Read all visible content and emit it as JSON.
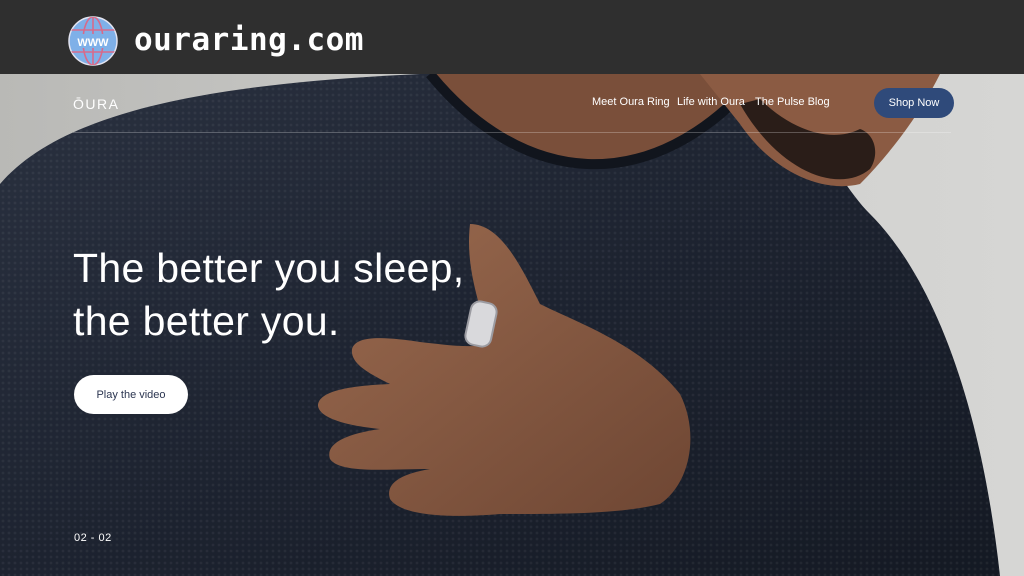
{
  "browser": {
    "url": "ouraring.com",
    "globe_label": "WWW"
  },
  "nav": {
    "logo": "ŌURA",
    "links": [
      "Meet Oura Ring",
      "Life with Oura",
      "The Pulse Blog"
    ],
    "cta": "Shop Now"
  },
  "hero": {
    "headline_line1": "The better you sleep,",
    "headline_line2": "the better you.",
    "play_label": "Play the video",
    "slide_counter": "02 - 02"
  },
  "colors": {
    "url_bar": "#2f2f2f",
    "shop_button": "#2f4a7a",
    "sweater": "#1e2430",
    "background": "#c9c9c7"
  }
}
